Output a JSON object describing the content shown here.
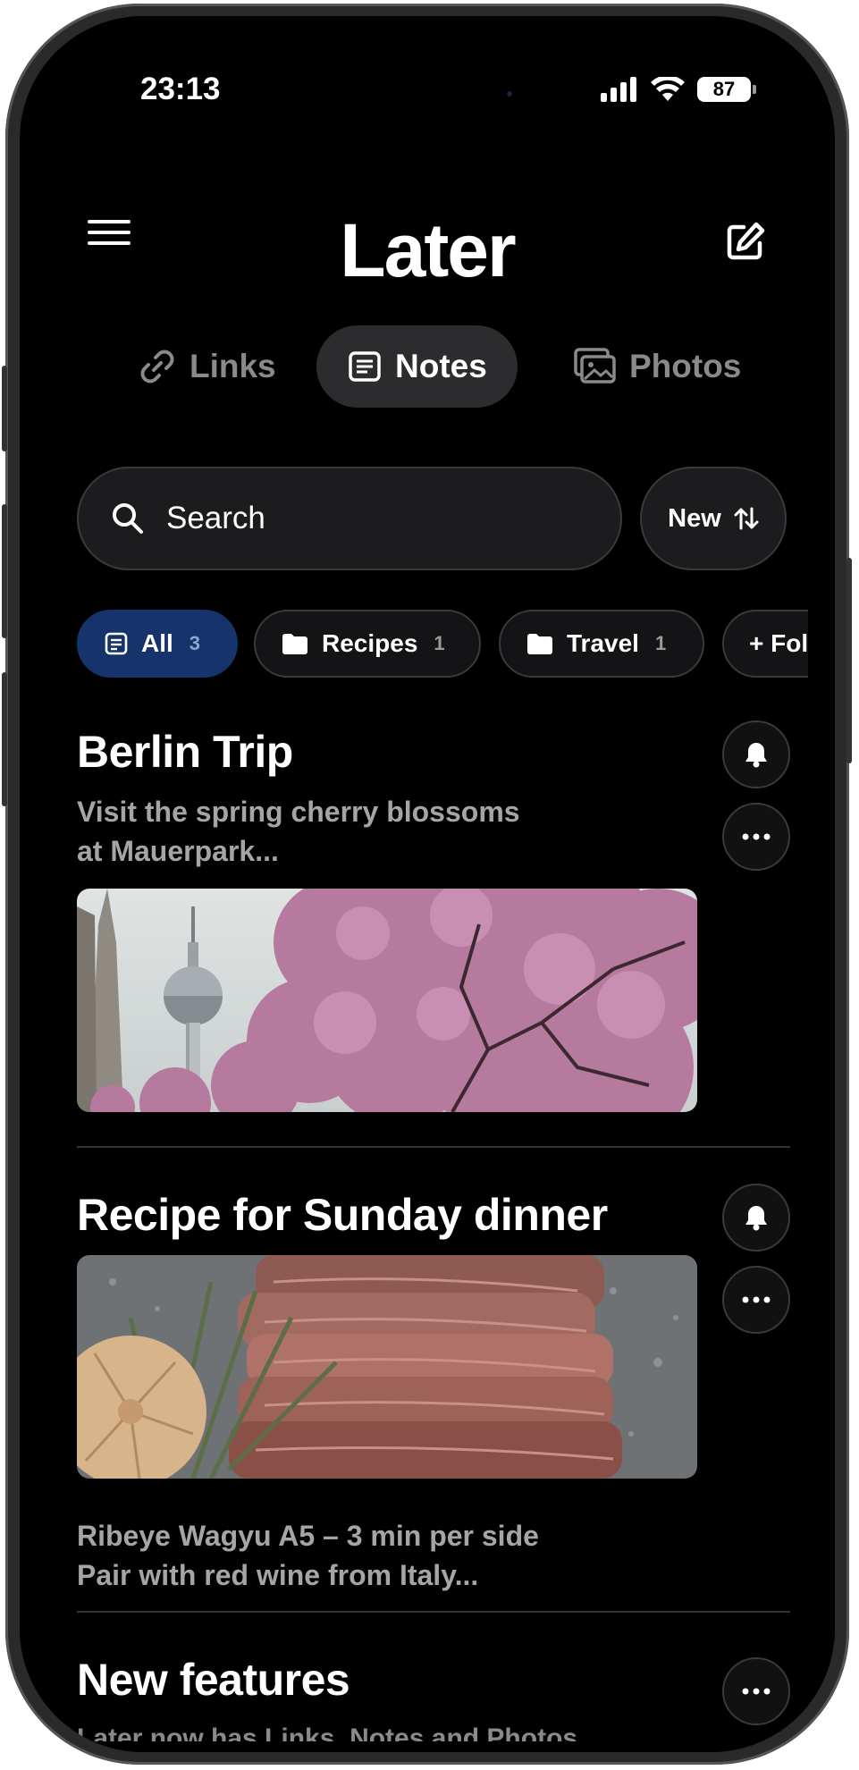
{
  "status": {
    "time": "23:13",
    "battery": "87"
  },
  "header": {
    "title": "Later"
  },
  "tabs": [
    {
      "label": "Links",
      "icon": "link-icon"
    },
    {
      "label": "Notes",
      "icon": "note-icon",
      "active": true
    },
    {
      "label": "Photos",
      "icon": "photos-icon"
    }
  ],
  "search": {
    "placeholder": "Search"
  },
  "sort": {
    "label": "New"
  },
  "chips": [
    {
      "label": "All",
      "count": "3",
      "icon": "note-icon",
      "active": true
    },
    {
      "label": "Recipes",
      "count": "1",
      "icon": "folder-icon"
    },
    {
      "label": "Travel",
      "count": "1",
      "icon": "folder-icon"
    },
    {
      "label": "+ Fol",
      "icon": "plus-icon"
    }
  ],
  "notes": [
    {
      "title": "Berlin Trip",
      "body": [
        "Visit the spring cherry blossoms",
        "at Mauerpark..."
      ]
    },
    {
      "title": "Recipe for Sunday dinner",
      "body": [
        "Ribeye Wagyu A5 – 3 min per side",
        "Pair with red wine from Italy..."
      ]
    },
    {
      "title": "New features",
      "body": [
        "Later now has Links, Notes and Photos"
      ]
    }
  ],
  "colors": {
    "accent_chip": "#17336b",
    "background": "#000000"
  }
}
